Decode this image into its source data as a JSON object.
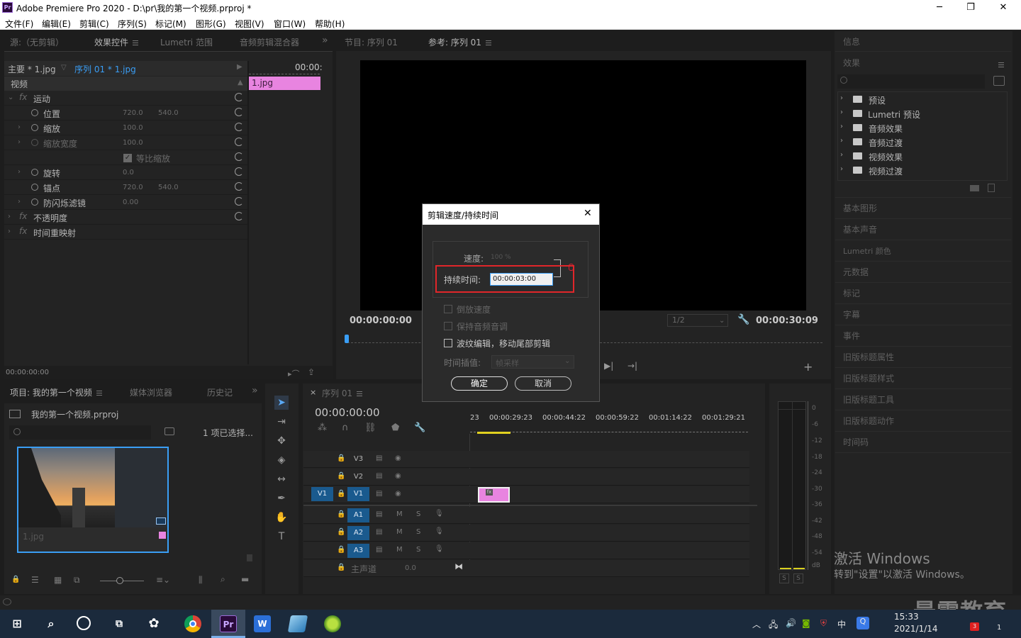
{
  "window": {
    "logo_text": "Pr",
    "title": "Adobe Premiere Pro 2020 - D:\\pr\\我的第一个视频.prproj *",
    "minimize": "─",
    "maximize": "❐",
    "close": "✕"
  },
  "menu": [
    "文件(F)",
    "编辑(E)",
    "剪辑(C)",
    "序列(S)",
    "标记(M)",
    "图形(G)",
    "视图(V)",
    "窗口(W)",
    "帮助(H)"
  ],
  "source_panel": {
    "tabs": [
      "源:（无剪辑）",
      "效果控件",
      "Lumetri 范围",
      "音频剪辑混合器"
    ],
    "more": "»",
    "master_label": "主要 * 1.jpg",
    "sequence_label": "序列 01 * 1.jpg",
    "timecode_head": "00:00:",
    "clip_label": "1.jpg",
    "section_video": "视频",
    "fx_label": "fx",
    "rows": [
      {
        "name": "运动",
        "v1": "",
        "v2": ""
      },
      {
        "name": "位置",
        "v1": "720.0",
        "v2": "540.0"
      },
      {
        "name": "缩放",
        "v1": "100.0",
        "v2": ""
      },
      {
        "name": "缩放宽度",
        "v1": "100.0",
        "v2": ""
      },
      {
        "name": "等比缩放",
        "v1": "",
        "v2": ""
      },
      {
        "name": "旋转",
        "v1": "0.0",
        "v2": ""
      },
      {
        "name": "锚点",
        "v1": "720.0",
        "v2": "540.0"
      },
      {
        "name": "防闪烁滤镜",
        "v1": "0.00",
        "v2": ""
      },
      {
        "name": "不透明度",
        "v1": "",
        "v2": ""
      },
      {
        "name": "时间重映射",
        "v1": "",
        "v2": ""
      }
    ],
    "bottom_time": "00:00:00:00"
  },
  "program_panel": {
    "tabs": [
      "节目: 序列 01",
      "参考: 序列 01"
    ],
    "time_left": "00:00:00:00",
    "time_right": "00:00:30:09",
    "zoom": "1/2",
    "add": "+"
  },
  "project_panel": {
    "tabs": [
      "项目: 我的第一个视频",
      "媒体浏览器",
      "历史记"
    ],
    "more": "»",
    "project_file": "我的第一个视频.prproj",
    "selection": "1 项已选择...",
    "thumb_label": "1.jpg"
  },
  "timeline_panel": {
    "tab": "序列 01",
    "close": "×",
    "timecode": "00:00:00:00",
    "ruler": [
      "23",
      "00:00:29:23",
      "00:00:44:22",
      "00:00:59:22",
      "00:01:14:22",
      "00:01:29:21"
    ],
    "tracks_video": [
      "V3",
      "V2",
      "V1"
    ],
    "tracks_audio": [
      "A1",
      "A2",
      "A3"
    ],
    "source_patch": "V1",
    "master": "主声道",
    "master_val": "0.0",
    "mute": "M",
    "solo": "S",
    "clip_fx": "fx"
  },
  "meter": {
    "scale": [
      "0",
      "-6",
      "-12",
      "-18",
      "-24",
      "-30",
      "-36",
      "-42",
      "-48",
      "-54",
      "dB"
    ],
    "solo_buttons": [
      "S",
      "S"
    ]
  },
  "right_panel": {
    "info": "信息",
    "effects": "效果",
    "effect_items": [
      "预设",
      "Lumetri 预设",
      "音频效果",
      "音频过渡",
      "视频效果",
      "视频过渡"
    ],
    "sections": [
      "基本图形",
      "基本声音",
      "Lumetri 颜色",
      "元数据",
      "标记",
      "字幕",
      "事件",
      "旧版标题属性",
      "旧版标题样式",
      "旧版标题工具",
      "旧版标题动作",
      "时间码"
    ]
  },
  "dialog": {
    "title": "剪辑速度/持续时间",
    "close": "✕",
    "speed_label": "速度:",
    "speed_value": "100 %",
    "duration_label": "持续时间:",
    "duration_value": "00:00:03:00",
    "reverse": "倒放速度",
    "keep_pitch": "保持音频音调",
    "ripple": "波纹编辑，移动尾部剪辑",
    "interp_label": "时间插值:",
    "interp_value": "帧采样",
    "ok": "确定",
    "cancel": "取消"
  },
  "watermark": {
    "activate_title": "激活 Windows",
    "activate_sub": "转到\"设置\"以激活 Windows。",
    "brand": "最需教育"
  },
  "taskbar": {
    "time": "15:33",
    "date": "2021/1/14",
    "ime": "中",
    "pr_label": "Pr",
    "notif_count": "3",
    "badge": "1"
  },
  "colors": {
    "accent_blue": "#3a9ef5",
    "clip_pink": "#e884e0",
    "track_blue": "#1a5a8e",
    "highlight_red": "#e0262a"
  }
}
